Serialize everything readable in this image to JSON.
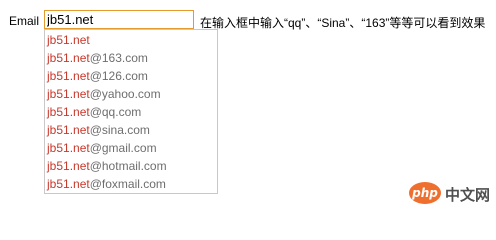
{
  "form": {
    "label": "Email",
    "input_value": "jb51.net",
    "hint": "在输入框中输入“qq”、“Sina”、“163”等等可以看到效果"
  },
  "suggestions": [
    {
      "typed": "jb51.net",
      "domain": ""
    },
    {
      "typed": "jb51.net",
      "domain": "@163.com"
    },
    {
      "typed": "jb51.net",
      "domain": "@126.com"
    },
    {
      "typed": "jb51.net",
      "domain": "@yahoo.com"
    },
    {
      "typed": "jb51.net",
      "domain": "@qq.com"
    },
    {
      "typed": "jb51.net",
      "domain": "@sina.com"
    },
    {
      "typed": "jb51.net",
      "domain": "@gmail.com"
    },
    {
      "typed": "jb51.net",
      "domain": "@hotmail.com"
    },
    {
      "typed": "jb51.net",
      "domain": "@foxmail.com"
    }
  ],
  "watermark": {
    "badge": "php",
    "text": "中文网"
  },
  "colors": {
    "input_border": "#e59a2e",
    "typed_text": "#c8382b",
    "domain_text": "#6e6e6e",
    "dropdown_border": "#c8c8c8",
    "logo_orange": "#ef6f2f"
  }
}
